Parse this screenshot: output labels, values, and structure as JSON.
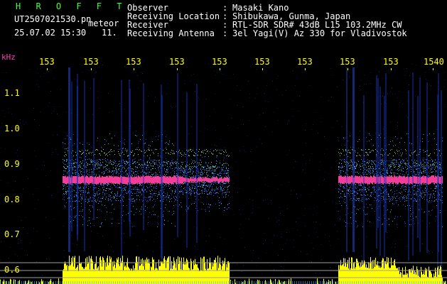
{
  "header": {
    "app_name": "H R O F F T",
    "file_name": "UT2507021530.pn",
    "mode_label": "meteor",
    "date_time": "25.07.02 15:30",
    "count": "11.",
    "fields": [
      {
        "label": "Observer",
        "value": "Masaki Kano"
      },
      {
        "label": "Receiving Location",
        "value": "Shibukawa, Gunma, Japan"
      },
      {
        "label": "Receiver",
        "value": "RTL-SDR SDR# 43dB L15 103.2MHz CW"
      },
      {
        "label": "Receiving Antenna",
        "value": "3el Yagi(V) Az 330 for Vladivostok"
      }
    ]
  },
  "axes": {
    "y_unit": "kHz",
    "y_ticks": [
      "1.1",
      "1.0",
      "0.9",
      "0.8",
      "0.7",
      "0.6"
    ],
    "x_ticks": [
      "153",
      "153",
      "153",
      "153",
      "153",
      "153",
      "153",
      "153",
      "153",
      "1540"
    ]
  },
  "colors": {
    "background": "#000000",
    "app_name": "#3fff3f",
    "header_text": "#ffffff",
    "ticks": "#ffff00",
    "units": "#ff3fb0",
    "signal_core": "#ff3fa0",
    "signal_halo": "#3070ff",
    "power_bars": "#ffff00"
  }
}
